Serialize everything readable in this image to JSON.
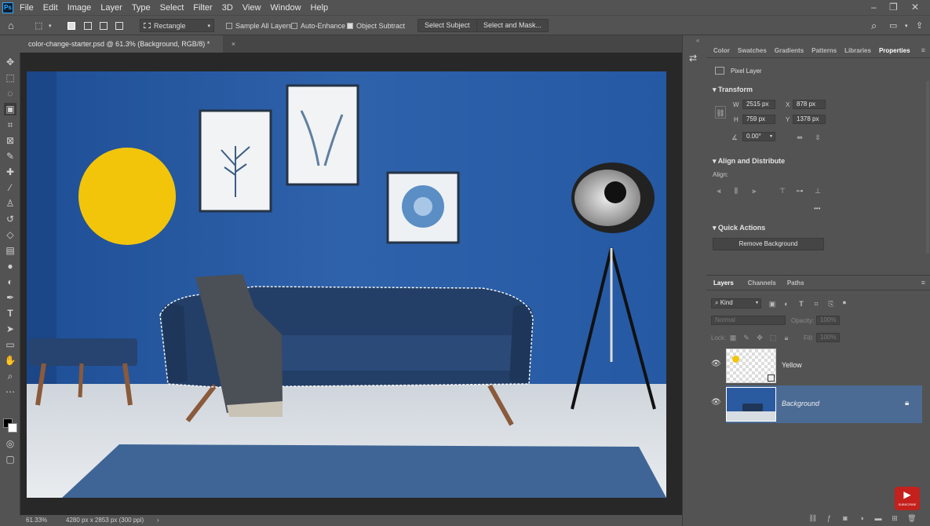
{
  "app": {
    "logo": "Ps"
  },
  "menu": [
    "File",
    "Edit",
    "Image",
    "Layer",
    "Type",
    "Select",
    "Filter",
    "3D",
    "View",
    "Window",
    "Help"
  ],
  "options": {
    "shape_select": "Rectangle",
    "sample_all_layers": "Sample All Layers",
    "auto_enhance": "Auto-Enhance",
    "object_subtract": "Object Subtract",
    "select_subject": "Select Subject",
    "select_and_mask": "Select and Mask..."
  },
  "document": {
    "tab_title": "color-change-starter.psd @ 61.3% (Background, RGB/8) *",
    "close": "×"
  },
  "status": {
    "zoom": "61.33%",
    "info": "4280 px x 2853 px (300 ppi)",
    "arrow": "›"
  },
  "panel_tabs": [
    "Color",
    "Swatches",
    "Gradients",
    "Patterns",
    "Libraries",
    "Properties"
  ],
  "properties": {
    "type": "Pixel Layer",
    "transform_title": "Transform",
    "w_label": "W",
    "w_value": "2515 px",
    "x_label": "X",
    "x_value": "878 px",
    "h_label": "H",
    "h_value": "759 px",
    "y_label": "Y",
    "y_value": "1378 px",
    "angle_value": "0.00°",
    "align_title": "Align and Distribute",
    "align_label": "Align:",
    "more": "•••",
    "quick_title": "Quick Actions",
    "remove_bg": "Remove Background"
  },
  "layers_panel": {
    "tabs": [
      "Layers",
      "Channels",
      "Paths"
    ],
    "kind": "Kind",
    "blend": "Normal",
    "opacity_label": "Opacity:",
    "opacity_value": "100%",
    "lock_label": "Lock:",
    "fill_label": "Fill:",
    "fill_value": "100%",
    "layers": [
      {
        "name": "Yellow",
        "selected": false
      },
      {
        "name": "Background",
        "selected": true
      }
    ]
  },
  "colors": {
    "accent_selected": "#4b6b94",
    "yellow": "#f2c50a",
    "wall": "#2a5faa"
  },
  "youtube": {
    "label": "SUBSCRIBE"
  }
}
